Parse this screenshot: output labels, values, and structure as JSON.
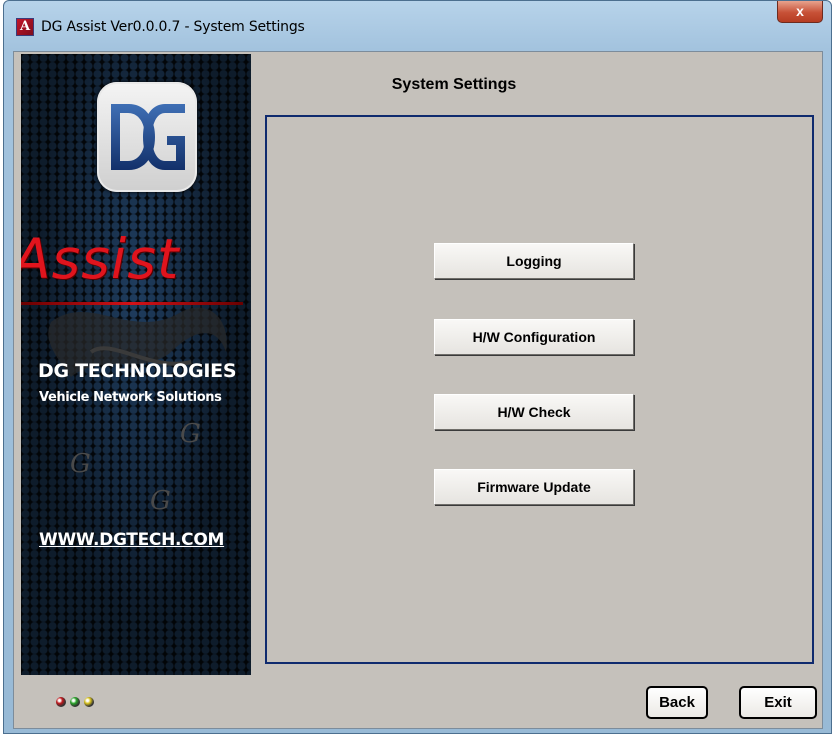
{
  "window": {
    "title": "DG Assist Ver0.0.0.7 - System Settings",
    "app_icon": "A",
    "close_label": "x"
  },
  "banner": {
    "product": "Assist",
    "company": "DG TECHNOLOGIES",
    "tagline": "Vehicle Network Solutions",
    "website": "WWW.DGTECH.COM"
  },
  "main": {
    "heading": "System Settings",
    "buttons": [
      "Logging",
      "H/W Configuration",
      "H/W Check",
      "Firmware Update"
    ]
  },
  "footer": {
    "back_label": "Back",
    "exit_label": "Exit",
    "leds": [
      {
        "name": "red",
        "color": "#c0171b"
      },
      {
        "name": "green",
        "color": "#2aa52a"
      },
      {
        "name": "yellow",
        "color": "#d8c21e"
      }
    ]
  },
  "colors": {
    "accent_red": "#e0141d",
    "panel_border": "#0f2a6e",
    "client_bg": "#c5c1bb"
  }
}
